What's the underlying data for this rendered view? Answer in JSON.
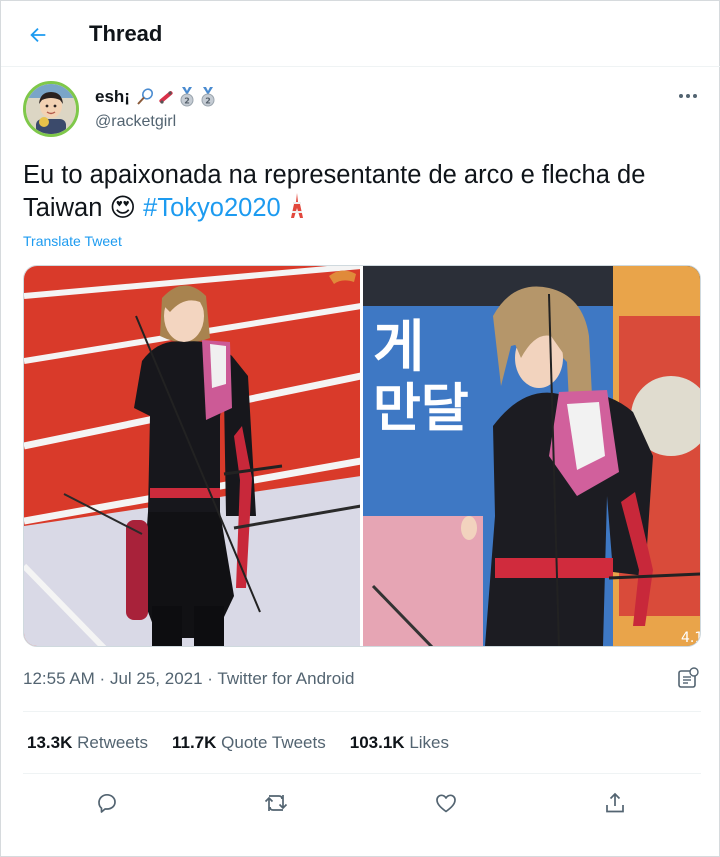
{
  "header": {
    "title": "Thread",
    "back_icon": "arrow-left-icon"
  },
  "author": {
    "display_name": "esh¡",
    "name_emojis": [
      "badminton-racket-emoji",
      "skateboard-emoji",
      "2nd-place-medal-emoji",
      "2nd-place-medal-emoji"
    ],
    "handle": "@racketgirl"
  },
  "tweet": {
    "line1": "Eu to apaixonada na representante de arco e flecha de",
    "line2_text": "Taiwan ",
    "line2_emoji": "😍",
    "hashtag": "#Tokyo2020",
    "line2_trailing_emoji": "tokyo-tower-emoji",
    "translate": "Translate Tweet"
  },
  "media": {
    "photos": [
      "archer-photo-red-field",
      "archer-photo-blue-banner"
    ],
    "banner_text": [
      "게",
      "만달"
    ],
    "banner_extra_text": "4.1"
  },
  "meta": {
    "time": "12:55 AM",
    "date": "Jul 25, 2021",
    "source": "Twitter for Android",
    "separator": " · "
  },
  "stats": {
    "retweets_count": "13.3K",
    "retweets_label": "Retweets",
    "quotes_count": "11.7K",
    "quotes_label": "Quote Tweets",
    "likes_count": "103.1K",
    "likes_label": "Likes"
  },
  "actions": [
    "reply-icon",
    "retweet-icon",
    "like-icon",
    "share-icon"
  ],
  "colors": {
    "accent": "#1d9bf0",
    "text": "#0f1419",
    "secondary": "#536471"
  }
}
